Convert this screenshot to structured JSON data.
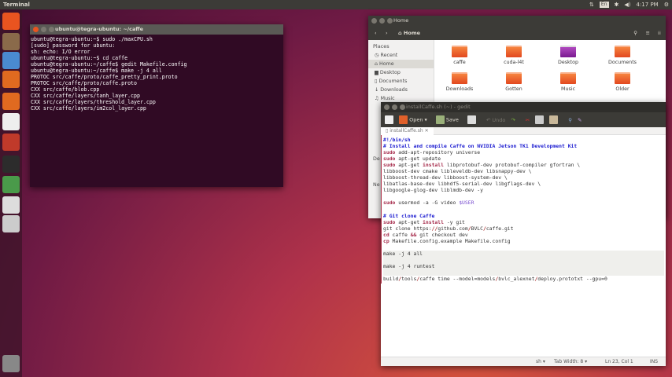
{
  "topbar": {
    "title": "Terminal",
    "keyboard": "En",
    "time": "4:17 PM"
  },
  "launcher": {
    "items": [
      {
        "icon": "ubuntu-dash-icon",
        "color": "#e95420"
      },
      {
        "icon": "files-icon",
        "color": "#8a6a4a"
      },
      {
        "icon": "chromium-icon",
        "color": "#4a8ad0"
      },
      {
        "icon": "firefox-icon",
        "color": "#e06a20"
      },
      {
        "icon": "software-center-icon",
        "color": "#e06a20"
      },
      {
        "icon": "amazon-icon",
        "color": "#eeeeee"
      },
      {
        "icon": "settings-icon",
        "color": "#c03a2a"
      },
      {
        "icon": "terminal-icon",
        "color": "#2c2c2c"
      },
      {
        "icon": "software-updater-icon",
        "color": "#4a9a4a"
      },
      {
        "icon": "text-editor-icon",
        "color": "#dddddd"
      },
      {
        "icon": "drive-icon",
        "color": "#cccccc"
      },
      {
        "icon": "trash-icon",
        "color": "#888888"
      }
    ]
  },
  "terminal": {
    "title": "ubuntu@tegra-ubuntu: ~/caffe",
    "output": "ubuntu@tegra-ubuntu:~$ sudo ./maxCPU.sh\n[sudo] password for ubuntu:\nsh: echo: I/O error\nubuntu@tegra-ubuntu:~$ cd caffe\nubuntu@tegra-ubuntu:~/caffe$ gedit Makefile.config\nubuntu@tegra-ubuntu:~/caffe$ make -j 4 all\nPROTOC src/caffe/proto/caffe_pretty_print.proto\nPROTOC src/caffe/proto/caffe.proto\nCXX src/caffe/blob.cpp\nCXX src/caffe/layers/tanh_layer.cpp\nCXX src/caffe/layers/threshold_layer.cpp\nCXX src/caffe/layers/im2col_layer.cpp"
  },
  "files": {
    "title": "Home",
    "breadcrumb": "Home",
    "places_header": "Places",
    "places": [
      "Recent",
      "Home",
      "Desktop",
      "Documents",
      "Downloads",
      "Music"
    ],
    "hidden_sidebar": [
      "De",
      "Ne"
    ],
    "items": [
      "caffe",
      "cuda-l4t",
      "Desktop",
      "Documents",
      "Downloads",
      "Gotten",
      "Music",
      "Older"
    ]
  },
  "gedit": {
    "title": "installCaffe.sh (~) - gedit",
    "toolbar": {
      "open": "Open",
      "save": "Save",
      "undo": "Undo"
    },
    "tab": "installCaffe.sh",
    "lines": [
      [
        [
          "#!/bin/sh",
          "c"
        ]
      ],
      [
        [
          "# Install and compile Caffe on NVIDIA Jetson TK1 Development Kit",
          "c"
        ]
      ],
      [
        [
          "sudo",
          "k"
        ],
        [
          " add-apt-repository universe",
          ""
        ]
      ],
      [
        [
          "sudo",
          "k"
        ],
        [
          " apt-get update",
          ""
        ]
      ],
      [
        [
          "sudo",
          "k"
        ],
        [
          " apt-get ",
          ""
        ],
        [
          "install",
          "k"
        ],
        [
          " libprotobuf-dev protobuf-compiler gfortran \\",
          ""
        ]
      ],
      [
        [
          "libboost-dev cmake libleveldb-dev libsnappy-dev \\",
          ""
        ]
      ],
      [
        [
          "libboost-thread-dev libboost-system-dev \\",
          ""
        ]
      ],
      [
        [
          "libatlas-base-dev libhdf5-serial-dev libgflags-dev \\",
          ""
        ]
      ],
      [
        [
          "libgoogle-glog-dev liblmdb-dev -y",
          ""
        ]
      ],
      [],
      [
        [
          "sudo",
          "k"
        ],
        [
          " usermod -a -G video ",
          ""
        ],
        [
          "$USER",
          "v"
        ]
      ],
      [],
      [
        [
          "# Git clone Caffe",
          "c"
        ]
      ],
      [
        [
          "sudo",
          "k"
        ],
        [
          " apt-get ",
          ""
        ],
        [
          "install",
          "k"
        ],
        [
          " -y git",
          ""
        ]
      ],
      [
        [
          "git clone https:",
          ""
        ],
        [
          "//",
          "s"
        ],
        [
          "github.com",
          ""
        ],
        [
          "/",
          "s"
        ],
        [
          "BVLC",
          ""
        ],
        [
          "/",
          "s"
        ],
        [
          "caffe.git",
          ""
        ]
      ],
      [
        [
          "cd",
          "k"
        ],
        [
          " caffe ",
          ""
        ],
        [
          "&&",
          "k"
        ],
        [
          " git checkout dev",
          ""
        ]
      ],
      [
        [
          "cp",
          "k"
        ],
        [
          " Makefile.config.example Makefile.config",
          ""
        ]
      ],
      [],
      [
        [
          "make -j 4 all",
          "",
          "hl"
        ]
      ],
      [
        [
          "",
          "",
          "hl"
        ]
      ],
      [
        [
          "make -j 4 runtest",
          "",
          "hl"
        ]
      ],
      [
        [
          "",
          "",
          "hl"
        ]
      ],
      [
        [
          "build",
          ""
        ],
        [
          "/",
          "s"
        ],
        [
          "tools",
          ""
        ],
        [
          "/",
          "s"
        ],
        [
          "caffe time --model=models",
          ""
        ],
        [
          "/",
          "s"
        ],
        [
          "bvlc_alexnet",
          ""
        ],
        [
          "/",
          "s"
        ],
        [
          "deploy.prototxt --gpu=0",
          ""
        ]
      ]
    ],
    "status": {
      "language": "sh ▾",
      "tab_width": "Tab Width: 8 ▾",
      "position": "Ln 23, Col 1",
      "mode": "INS"
    }
  }
}
